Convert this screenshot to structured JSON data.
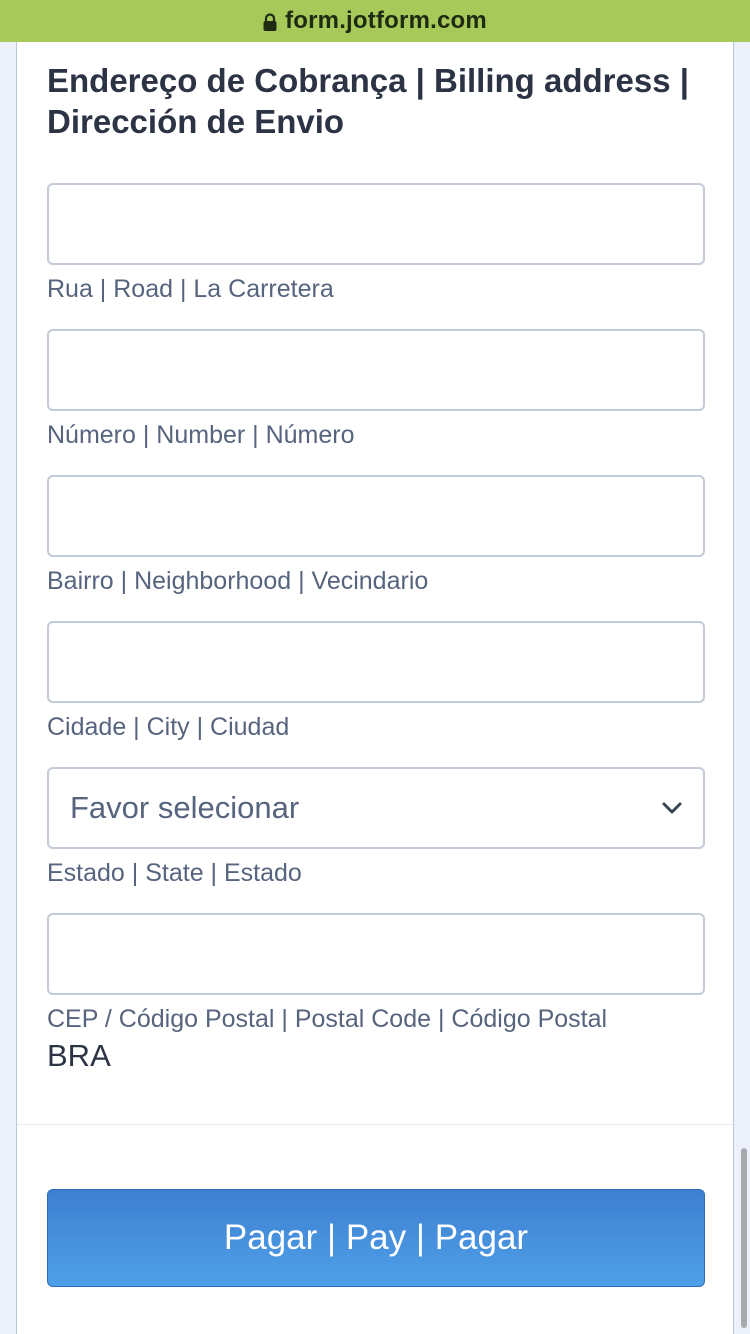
{
  "browser": {
    "url": "form.jotform.com"
  },
  "form": {
    "section_title": "Endereço de Cobrança | Billing address | Dirección de Envio",
    "fields": {
      "street": {
        "value": "",
        "sublabel": "Rua | Road | La Carretera"
      },
      "number": {
        "value": "",
        "sublabel": "Número | Number | Número"
      },
      "neighborhood": {
        "value": "",
        "sublabel": "Bairro | Neighborhood | Vecindario"
      },
      "city": {
        "value": "",
        "sublabel": "Cidade | City | Ciudad"
      },
      "state": {
        "selected": "Favor selecionar",
        "sublabel": "Estado | State | Estado"
      },
      "postal_code": {
        "value": "",
        "sublabel": "CEP / Código Postal | Postal Code | Código Postal"
      }
    },
    "country_code": "BRA",
    "pay_button_label": "Pagar | Pay | Pagar"
  },
  "colors": {
    "url_bar": "#a6c95a",
    "button_start": "#3d7fd0",
    "button_end": "#4fa0e8",
    "label_text": "#57647e",
    "title_text": "#2c3345"
  },
  "icons": {
    "lock": "lock-icon",
    "dropdown": "chevron-down-icon"
  }
}
